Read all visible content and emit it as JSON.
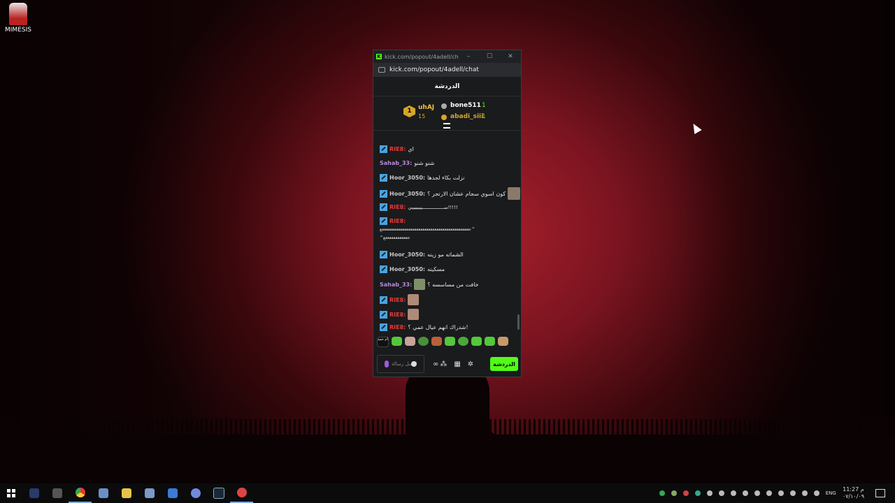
{
  "desktop": {
    "icon_label": "MIMESIS"
  },
  "window": {
    "title": "kick.com/popout/4adell/cha...",
    "url": "kick.com/popout/4adell/chat",
    "minimize": "–",
    "maximize": "☐",
    "close": "✕"
  },
  "chat": {
    "header": "الدردشة",
    "leaderboard": {
      "rank": "1",
      "top_name": "uhAJ",
      "top_count": "15",
      "second_name": "bone511",
      "second_count": "1",
      "third_name": "abadi_siii",
      "third_count": "1"
    },
    "messages": [
      {
        "user": "RIE8",
        "text": "اي",
        "mod": true,
        "color": "red",
        "emote": false
      },
      {
        "user": "Sahab_33",
        "text": "شنو شنو",
        "mod": false,
        "color": "purple",
        "emote": false
      },
      {
        "user": "Hoor_3050",
        "text": "نزلت بكاء لجدها",
        "mod": true,
        "color": "gray",
        "emote": false
      },
      {
        "user": "Hoor_3050",
        "text": "كون اسوي سجام عشان الارتجر ؟",
        "mod": true,
        "color": "gray",
        "emote": true
      },
      {
        "user": "RIE8",
        "text": "ســـــــــــــــيييييييي!!!!!",
        "mod": true,
        "color": "red",
        "emote": false
      },
      {
        "user": "RIE8",
        "text": "ععععععععععععععععععععععععععععععععععععععععععععع^",
        "mod": true,
        "color": "red",
        "emote": false
      },
      {
        "user": "",
        "text": "^ععععععععععععع",
        "mod": false,
        "color": "gray",
        "emote": false
      },
      {
        "user": "Hoor_3050",
        "text": "الشماته مو زينه",
        "mod": true,
        "color": "gray",
        "emote": false
      },
      {
        "user": "Hoor_3050",
        "text": "مسكينه",
        "mod": true,
        "color": "gray",
        "emote": false
      },
      {
        "user": "Sahab_33",
        "text": "خافت من مساسسه ؟",
        "mod": false,
        "color": "purple",
        "emote": true
      },
      {
        "user": "RIE8",
        "text": "",
        "mod": true,
        "color": "red",
        "emote": true
      },
      {
        "user": "RIE8",
        "text": "",
        "mod": true,
        "color": "red",
        "emote": true
      },
      {
        "user": "RIE8",
        "text": "شدراك انهم عيال عمي ؟!",
        "mod": true,
        "color": "red",
        "emote": false
      }
    ],
    "input_placeholder": "ارسل رسالة",
    "send_label": "الدردشة",
    "emote_row_label": "أم حمد"
  },
  "taskbar": {
    "lang": "ENG",
    "time": "11:27 م",
    "date": "٠٧/١٠/٠٩"
  },
  "colors": {
    "kick_green": "#53fc18",
    "mod_blue": "#4aa3df",
    "user_red": "#e63a3a",
    "user_purple": "#b98ad8"
  }
}
